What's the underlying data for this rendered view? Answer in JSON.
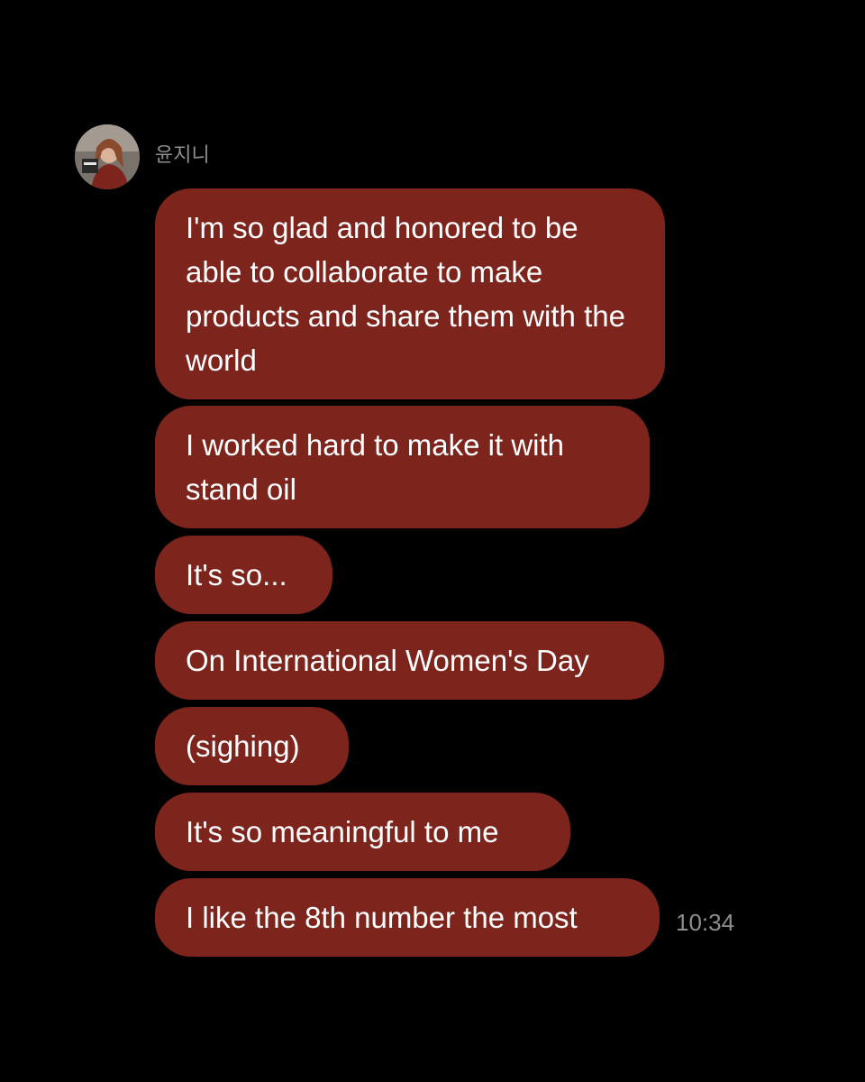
{
  "sender": {
    "name": "윤지니",
    "avatar_icon": "profile-photo-icon"
  },
  "messages": [
    {
      "text": "I'm so glad and honored to be able to collaborate to make products and share them with the world"
    },
    {
      "text": "I worked hard to make it with stand oil"
    },
    {
      "text": "It's so..."
    },
    {
      "text": "On International Women's Day"
    },
    {
      "text": "(sighing)"
    },
    {
      "text": "It's so meaningful to me"
    },
    {
      "text": "I like the 8th number the most"
    }
  ],
  "timestamp": "10:34",
  "colors": {
    "background": "#000000",
    "bubble": "#7d241d",
    "bubble_text": "#ffffff",
    "meta_text": "#8e8e8e"
  }
}
